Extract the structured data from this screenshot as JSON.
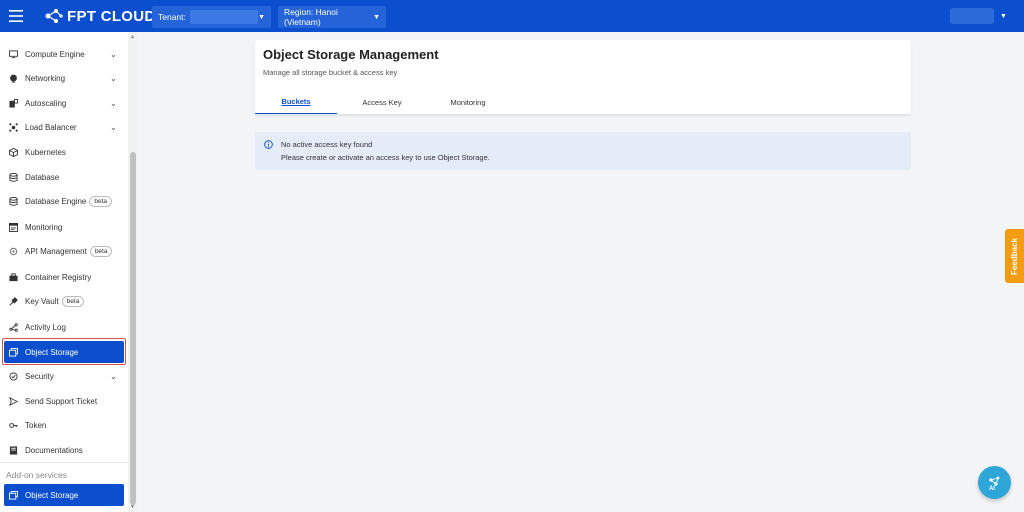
{
  "topbar": {
    "brand": "FPT CLOUD",
    "tenant_label": "Tenant:",
    "region_label": "Region: Hanoi (Vietnam)"
  },
  "sidebar": {
    "items": [
      {
        "label": "Compute Engine",
        "icon": "monitor-icon",
        "chevron": true
      },
      {
        "label": "Networking",
        "icon": "globe-icon",
        "chevron": true
      },
      {
        "label": "Autoscaling",
        "icon": "autoscaling-icon",
        "chevron": true
      },
      {
        "label": "Load Balancer",
        "icon": "load-balancer-icon",
        "chevron": true
      },
      {
        "label": "Kubernetes",
        "icon": "cube-icon",
        "chevron": false
      },
      {
        "label": "Database",
        "icon": "database-icon",
        "chevron": false
      },
      {
        "label": "Database Engine",
        "icon": "database-engine-icon",
        "badge": "beta"
      },
      {
        "label": "Monitoring",
        "icon": "monitoring-icon",
        "chevron": false
      },
      {
        "label": "API Management",
        "icon": "api-gear-icon",
        "badge": "beta"
      },
      {
        "label": "Container Registry",
        "icon": "container-icon",
        "chevron": false
      },
      {
        "label": "Key Vault",
        "icon": "key-icon",
        "badge": "beta"
      },
      {
        "label": "Activity Log",
        "icon": "activity-log-icon",
        "chevron": false
      },
      {
        "label": "Object Storage",
        "icon": "object-storage-icon",
        "active": true
      },
      {
        "label": "Security",
        "icon": "shield-icon",
        "chevron": true
      },
      {
        "label": "Send Support Ticket",
        "icon": "send-icon",
        "chevron": false
      },
      {
        "label": "Token",
        "icon": "token-icon",
        "chevron": false
      },
      {
        "label": "Documentations",
        "icon": "document-icon",
        "chevron": false
      }
    ],
    "addon_label": "Add-on services",
    "addon_item": {
      "label": "Object Storage",
      "icon": "object-storage-icon"
    }
  },
  "main": {
    "title": "Object Storage Management",
    "subtitle": "Manage all storage bucket & access key",
    "tabs": [
      {
        "label": "Buckets",
        "active": true
      },
      {
        "label": "Access Key",
        "active": false
      },
      {
        "label": "Monitoring",
        "active": false
      }
    ],
    "alert": {
      "line1": "No active access key found",
      "line2": "Please create or activate an access key to use Object Storage."
    }
  },
  "feedback_label": "Feedback",
  "colors": {
    "brand": "#0b4fce",
    "alert_bg": "#e4ecf8",
    "feedback": "#f39c12",
    "ai_button": "#2fa6d8"
  }
}
